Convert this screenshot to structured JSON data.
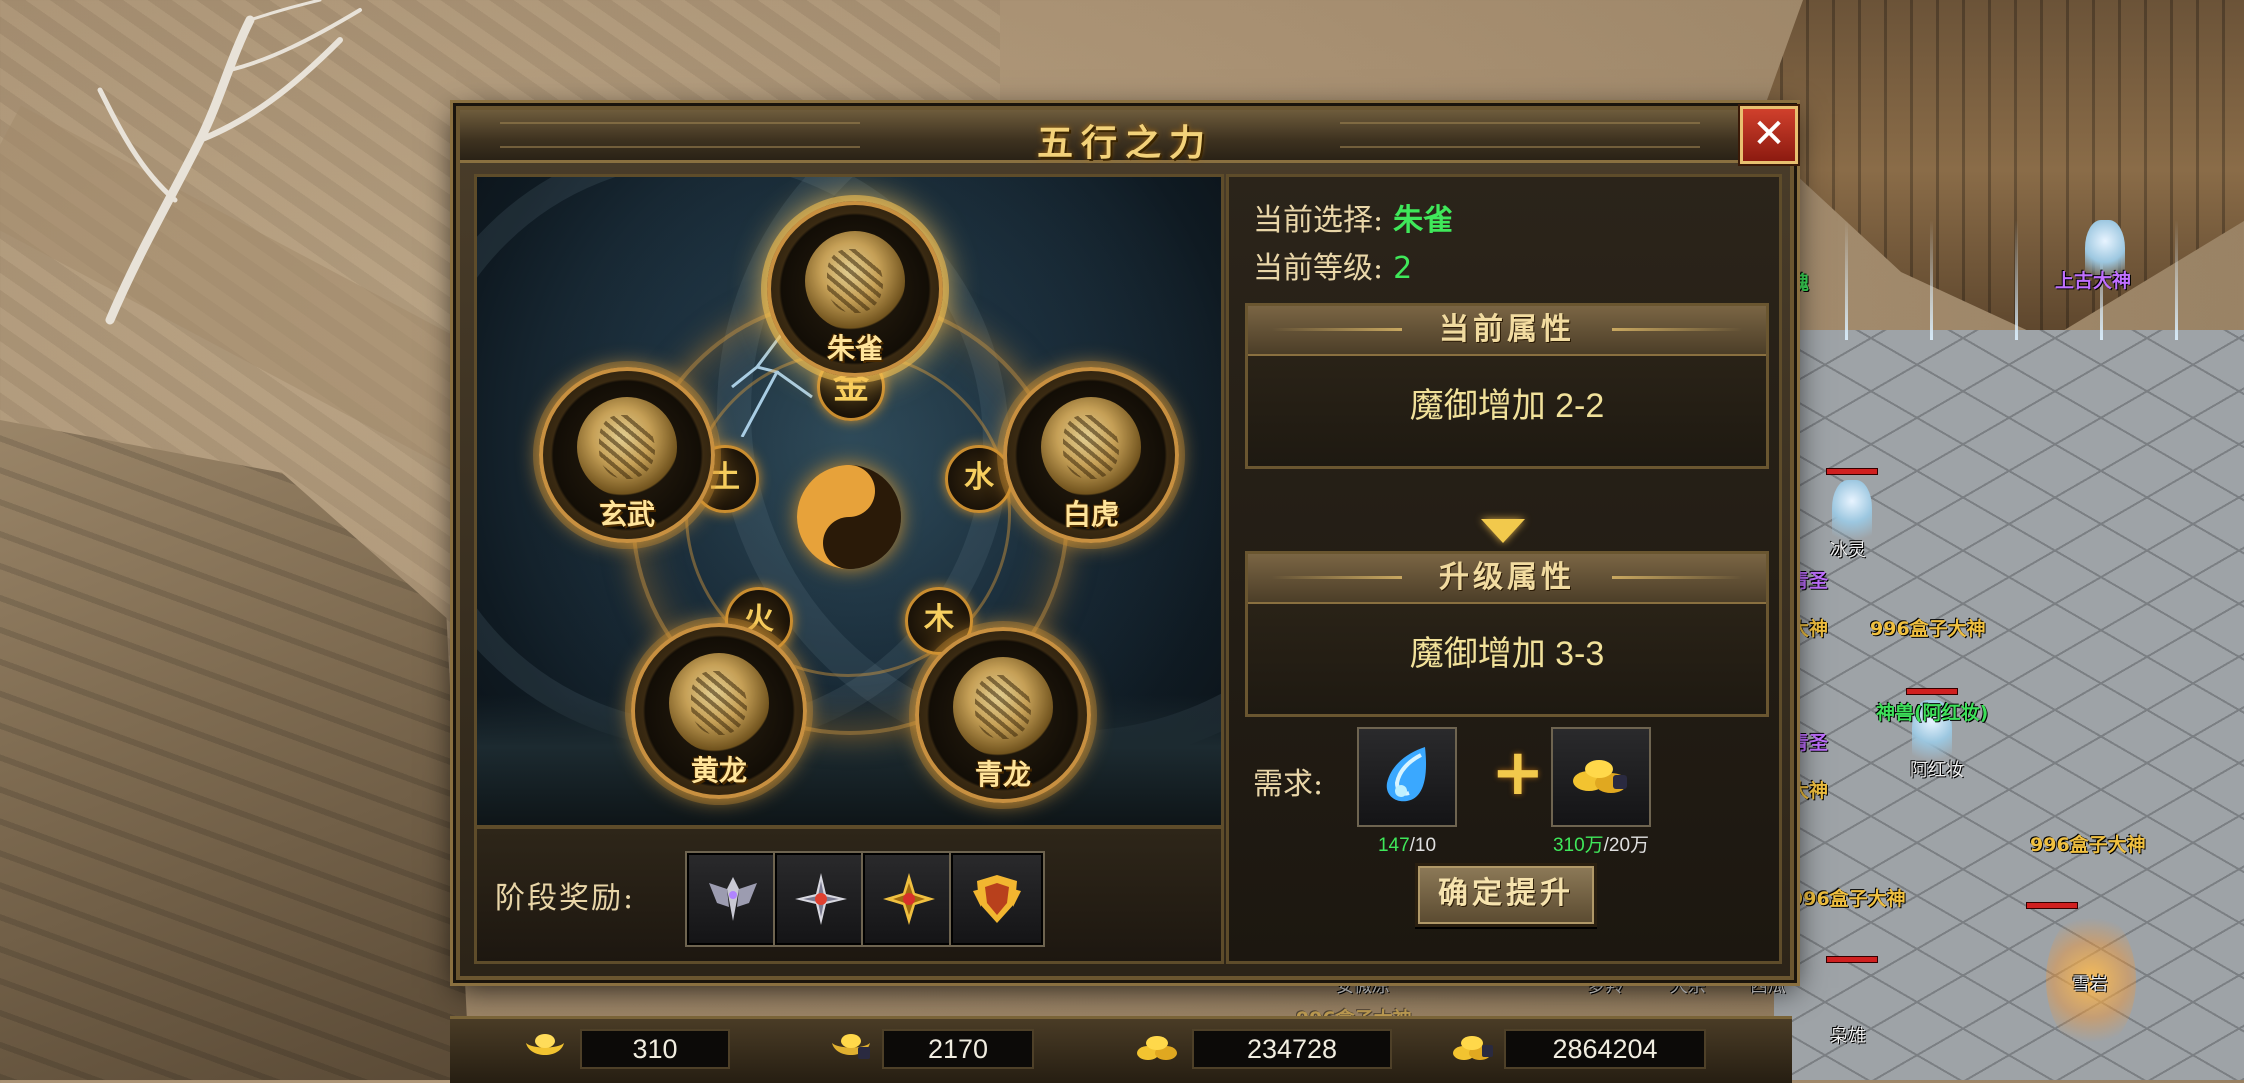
{
  "dialog": {
    "title": "五行之力",
    "close_label": "✕"
  },
  "beasts": [
    {
      "name": "朱雀",
      "selected": true
    },
    {
      "name": "白虎",
      "selected": false
    },
    {
      "name": "青龙",
      "selected": false
    },
    {
      "name": "黄龙",
      "selected": false
    },
    {
      "name": "玄武",
      "selected": false
    }
  ],
  "elements": [
    "金",
    "水",
    "木",
    "火",
    "土"
  ],
  "info": {
    "current_select_label": "当前选择:",
    "current_select_value": "朱雀",
    "current_level_label": "当前等级:",
    "current_level_value": "2",
    "current_attr_header": "当前属性",
    "current_attr_value": "魔御增加 2-2",
    "upgrade_attr_header": "升级属性",
    "upgrade_attr_value": "魔御增加 3-3",
    "need_label": "需求:",
    "need_items": [
      {
        "icon": "blue-crystal-icon",
        "have": "147",
        "need": "/10"
      },
      {
        "icon": "gold-ingot-pile-icon",
        "have": "310万",
        "need": "/20万"
      }
    ],
    "plus": "+",
    "confirm_label": "确定提升"
  },
  "rewards": {
    "label": "阶段奖励:",
    "items": [
      "silver-wings-badge-icon",
      "silver-star-gem-icon",
      "gold-star-gem-icon",
      "gold-crest-icon"
    ]
  },
  "currency": [
    {
      "icon": "gold-ingot-icon",
      "value": "310"
    },
    {
      "icon": "bound-gold-ingot-icon",
      "value": "2170"
    },
    {
      "icon": "gold-coins-icon",
      "value": "234728"
    },
    {
      "icon": "bound-gold-coins-icon",
      "value": "2864204"
    }
  ],
  "world_labels": [
    "上古大神",
    "魂",
    "冰灵",
    "青圣",
    "大神",
    "996盒子大神",
    "神兽(阿红妆)",
    "青圣",
    "阿红妆",
    "大神",
    "996盒子大神",
    "996盒子大神",
    "安微凉",
    "梦羚",
    "大宗",
    "西瓜",
    "雪岩",
    "枭雄",
    "996盒子大神"
  ],
  "colors": {
    "accent_gold": "#f3d27a",
    "value_green": "#3fe85a",
    "close_red": "#c0341f"
  }
}
